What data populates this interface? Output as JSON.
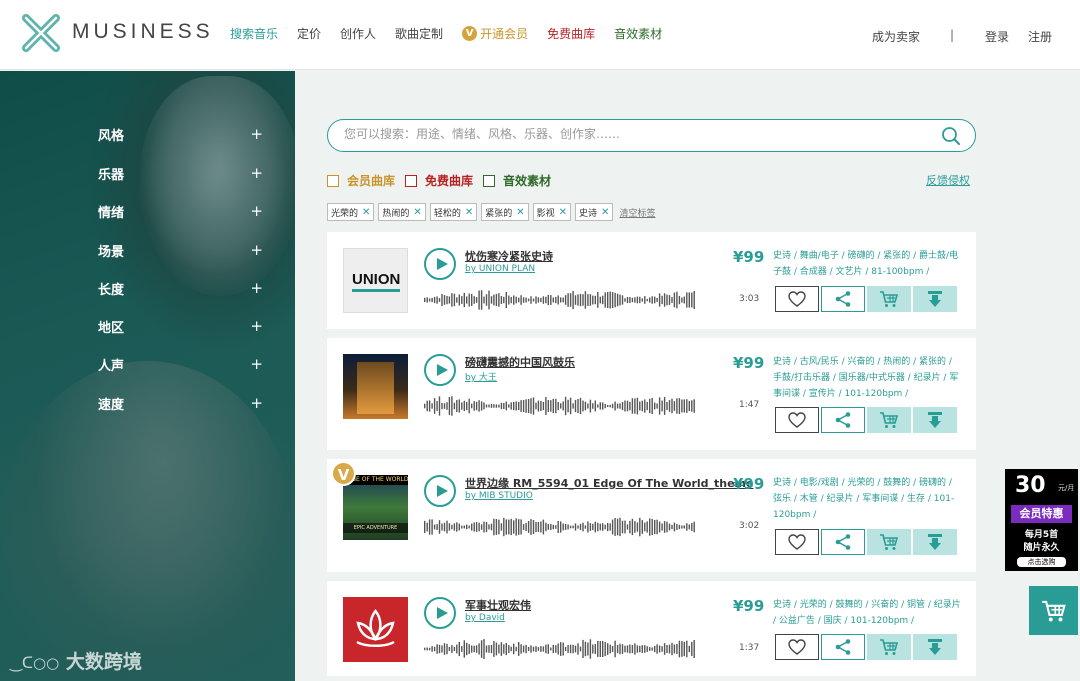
{
  "brand": {
    "name": "MUSINESS"
  },
  "nav": {
    "items": [
      "搜索音乐",
      "定价",
      "创作人",
      "歌曲定制"
    ],
    "vip_badge": "V",
    "vip": "开通会员",
    "free": "免费曲库",
    "sfx": "音效素材"
  },
  "header_right": {
    "sell": "成为卖家",
    "divider": "|",
    "login": "登录",
    "register": "注册"
  },
  "sidebar": {
    "filters": [
      "风格",
      "乐器",
      "情绪",
      "场景",
      "长度",
      "地区",
      "人声",
      "速度"
    ],
    "plus": "+",
    "watermark": "大数跨境"
  },
  "search": {
    "placeholder": "您可以搜索：用途、情绪、风格、乐器、创作家……",
    "value": ""
  },
  "libraries": [
    "会员曲库",
    "免费曲库",
    "音效素材"
  ],
  "report_link": "反馈侵权",
  "tags": [
    "光荣的",
    "热闹的",
    "轻松的",
    "紧张的",
    "影视",
    "史诗"
  ],
  "clear_tags": "清空标签",
  "tracks": [
    {
      "title": "忧伤寒冷紧张史诗",
      "author": "by UNION PLAN",
      "cover_text": "UNION",
      "price": "¥99",
      "duration": "3:03",
      "desc": "史诗 / 舞曲/电子 / 磅礴的 / 紧张的 / 爵士鼓/电子鼓 / 合成器 / 文艺片 / 81-100bpm /"
    },
    {
      "title": "磅礴震撼的中国风鼓乐",
      "author": "by 大王",
      "cover_text": "",
      "price": "¥99",
      "duration": "1:47",
      "desc": "史诗 / 古风/民乐 / 兴奋的 / 热闹的 / 紧张的 / 手鼓/打击乐器 / 国乐器/中式乐器 / 纪录片 / 军事间谍 / 宣传片 / 101-120bpm /"
    },
    {
      "title": "世界边缘 RM_5594_01 Edge Of The World_theme",
      "author": "by MIB STUDIO",
      "cover_text": "EDGE OF THE WORLD",
      "cover_sub": "EPIC ADVENTURE",
      "vip_badge": "V",
      "price": "¥99",
      "duration": "3:02",
      "desc": "史诗 / 电影/戏剧 / 光荣的 / 鼓舞的 / 磅礴的 / 弦乐 / 木管 / 纪录片 / 军事间谍 / 生存 / 101-120bpm /"
    },
    {
      "title": "军事壮观宏伟",
      "author": "by David",
      "cover_text": "",
      "price": "¥99",
      "duration": "1:37",
      "desc": "史诗 / 光荣的 / 鼓舞的 / 兴奋的 / 铜管 / 纪录片 / 公益广告 / 国庆 / 101-120bpm /"
    }
  ],
  "action_icons": [
    "heart-icon",
    "share-icon",
    "cart-icon",
    "download-icon"
  ],
  "promo": {
    "price": "30",
    "unit": "元/月",
    "badge": "会员特惠",
    "line1": "每月5首",
    "line2": "随片永久",
    "cta": "点击选购"
  },
  "colors": {
    "accent": "#2a9c96",
    "vip": "#c9942b",
    "free": "#b72323",
    "sfx": "#2f6a2a",
    "sidebar": "#0f4d48"
  }
}
